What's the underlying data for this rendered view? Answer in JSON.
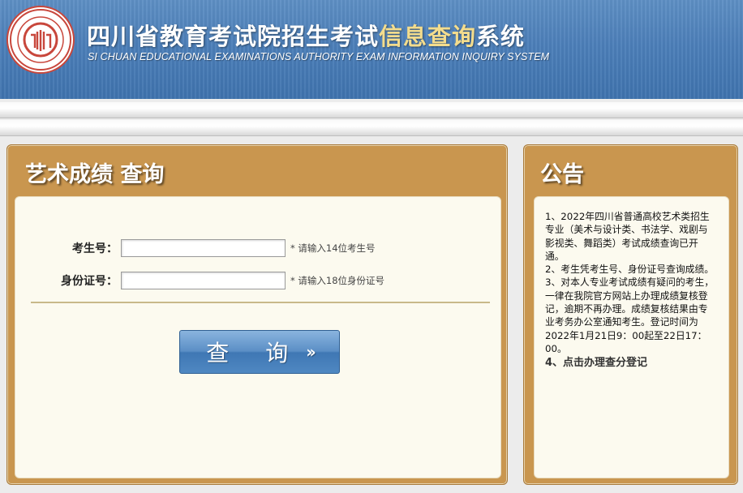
{
  "header": {
    "title_part1": "四川省教育考试院招生考试",
    "title_highlight": "信息查询",
    "title_part2": "系统",
    "subtitle": "SI CHUAN EDUCATIONAL EXAMINATIONS AUTHORITY EXAM INFORMATION INQUIRY SYSTEM",
    "logo_icon": "sichuan-exam-authority-seal"
  },
  "query_panel": {
    "title": "艺术成绩  查询",
    "fields": [
      {
        "label": "考生号：",
        "value": "",
        "hint": "* 请输入14位考生号"
      },
      {
        "label": "身份证号：",
        "value": "",
        "hint": "* 请输入18位身份证号"
      }
    ],
    "submit_label": "查 询",
    "submit_icon": "double-chevron-right"
  },
  "notice_panel": {
    "title": "公告",
    "items": [
      "1、2022年四川省普通高校艺术类招生专业（美术与设计类、书法学、戏剧与影视类、舞蹈类）考试成绩查询已开通。",
      "2、考生凭考生号、身份证号查询成绩。",
      "3、对本人专业考试成绩有疑问的考生，一律在我院官方网站上办理成绩复核登记，逾期不再办理。成绩复核结果由专业考务办公室通知考生。登记时间为2022年1月21日9：00起至22日17：00。"
    ],
    "link_text": "4、点击办理查分登记"
  },
  "colors": {
    "header_blue": "#4c7fb9",
    "panel_gold": "#c9964f",
    "panel_body": "#fcfaef",
    "title_highlight": "#f3dc8d",
    "button_blue": "#4f88c2"
  }
}
